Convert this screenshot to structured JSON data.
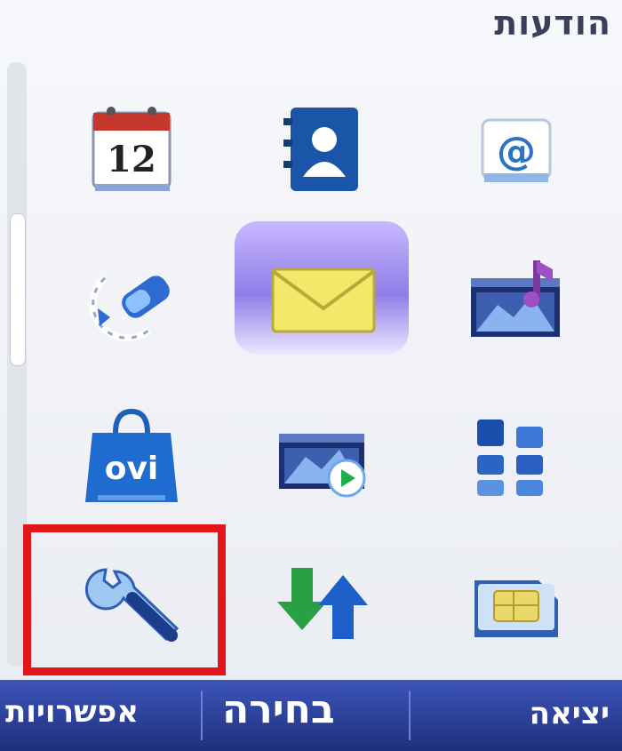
{
  "header": {
    "title": "הודעות"
  },
  "menu": {
    "rows": [
      [
        {
          "icon": "email-icon"
        },
        {
          "icon": "contacts-icon"
        },
        {
          "icon": "calendar-icon",
          "text": "12"
        }
      ],
      [
        {
          "icon": "music-player-icon"
        },
        {
          "icon": "messaging-icon",
          "selected": true
        },
        {
          "icon": "call-log-icon"
        }
      ],
      [
        {
          "icon": "applications-icon"
        },
        {
          "icon": "video-icon"
        },
        {
          "icon": "ovi-store-icon",
          "text": "ovi"
        }
      ],
      [
        {
          "icon": "sim-card-icon"
        },
        {
          "icon": "transfer-icon"
        },
        {
          "icon": "settings-wrench-icon",
          "marked": true
        }
      ]
    ]
  },
  "softkeys": {
    "left": "אפשרויות",
    "center": "בחירה",
    "right": "יציאה"
  },
  "colors": {
    "softkey_bar": "#2a3d98",
    "highlight_marker": "#e4141b",
    "selection": "#8f7de8"
  }
}
